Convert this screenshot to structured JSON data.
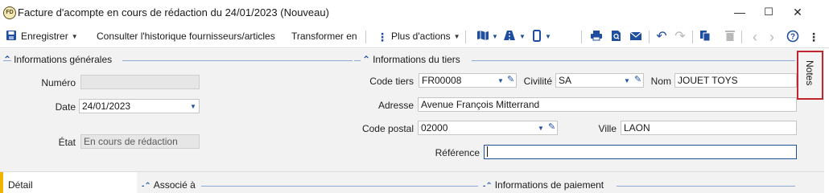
{
  "window": {
    "title": "Facture d'acompte en cours de rédaction du 24/01/2023 (Nouveau)",
    "app_icon_text": "FD",
    "minimize": "—",
    "maximize": "☐",
    "close": "✕"
  },
  "toolbar": {
    "save": "Enregistrer",
    "history": "Consulter l'historique fournisseurs/articles",
    "transform": "Transformer en",
    "more_actions": "Plus d'actions"
  },
  "general": {
    "heading": "Informations générales",
    "numero_label": "Numéro",
    "numero_value": "",
    "date_label": "Date",
    "date_value": "24/01/2023",
    "etat_label": "État",
    "etat_value": "En cours de rédaction"
  },
  "tiers": {
    "heading": "Informations du tiers",
    "code_label": "Code tiers",
    "code_value": "FR00008",
    "civilite_label": "Civilité",
    "civilite_value": "SA",
    "nom_label": "Nom",
    "nom_value": "JOUET TOYS",
    "adresse_label": "Adresse",
    "adresse_value": "Avenue François Mitterrand",
    "cp_label": "Code postal",
    "cp_value": "02000",
    "ville_label": "Ville",
    "ville_value": "LAON",
    "reference_label": "Référence",
    "reference_value": ""
  },
  "side_tab": {
    "notes": "Notes"
  },
  "bottom": {
    "detail_tab": "Détail",
    "associe": "Associé à",
    "paiement": "Informations de paiement"
  }
}
